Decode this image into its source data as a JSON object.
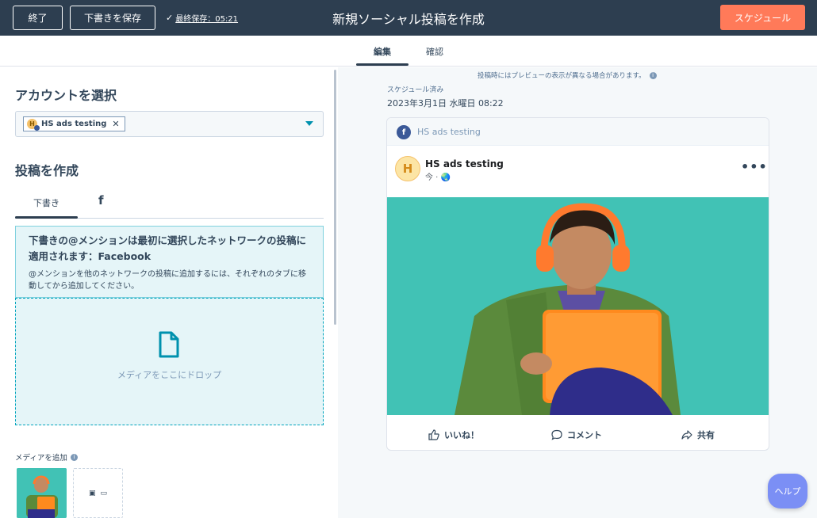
{
  "topbar": {
    "exit_label": "終了",
    "save_draft_label": "下書きを保存",
    "last_saved": "最終保存：05:21",
    "title": "新規ソーシャル投稿を作成",
    "schedule_label": "スケジュール"
  },
  "tabs": [
    {
      "label": "編集",
      "active": true
    },
    {
      "label": "確認",
      "active": false
    }
  ],
  "left": {
    "account_heading": "アカウントを選択",
    "selected_account": "HS ads testing",
    "chip_remove": "✕",
    "compose_heading": "投稿を作成",
    "compose_tabs": [
      {
        "label": "下書き",
        "active": true
      },
      {
        "label": "f",
        "icon": "facebook-icon"
      }
    ],
    "notice_title": "下書きの@メンションは最初に選択したネットワークの投稿に適用されます：Facebook",
    "notice_body": "@メンションを他のネットワークの投稿に追加するには、それぞれのタブに移動してから追加してください。",
    "drop_text": "メディアをここにドロップ",
    "media_label": "メディアを追加"
  },
  "preview": {
    "note": "投稿時にはプレビューの表示が異なる場合があります。",
    "scheduled_label": "スケジュール済み",
    "scheduled_date": "2023年3月1日 水曜日 08:22",
    "network_account": "HS ads testing",
    "avatar_letter": "H",
    "post_author": "HS ads testing",
    "post_meta": "今 · 🌏",
    "more": "•••",
    "like": "いいね！",
    "comment": "コメント",
    "share": "共有"
  },
  "help_label": "ヘルプ",
  "colors": {
    "topbar": "#2d3e50",
    "accent_orange": "#ff7a59",
    "teal": "#00a4bd",
    "facebook": "#3b5998",
    "help": "#7b8ff5"
  }
}
